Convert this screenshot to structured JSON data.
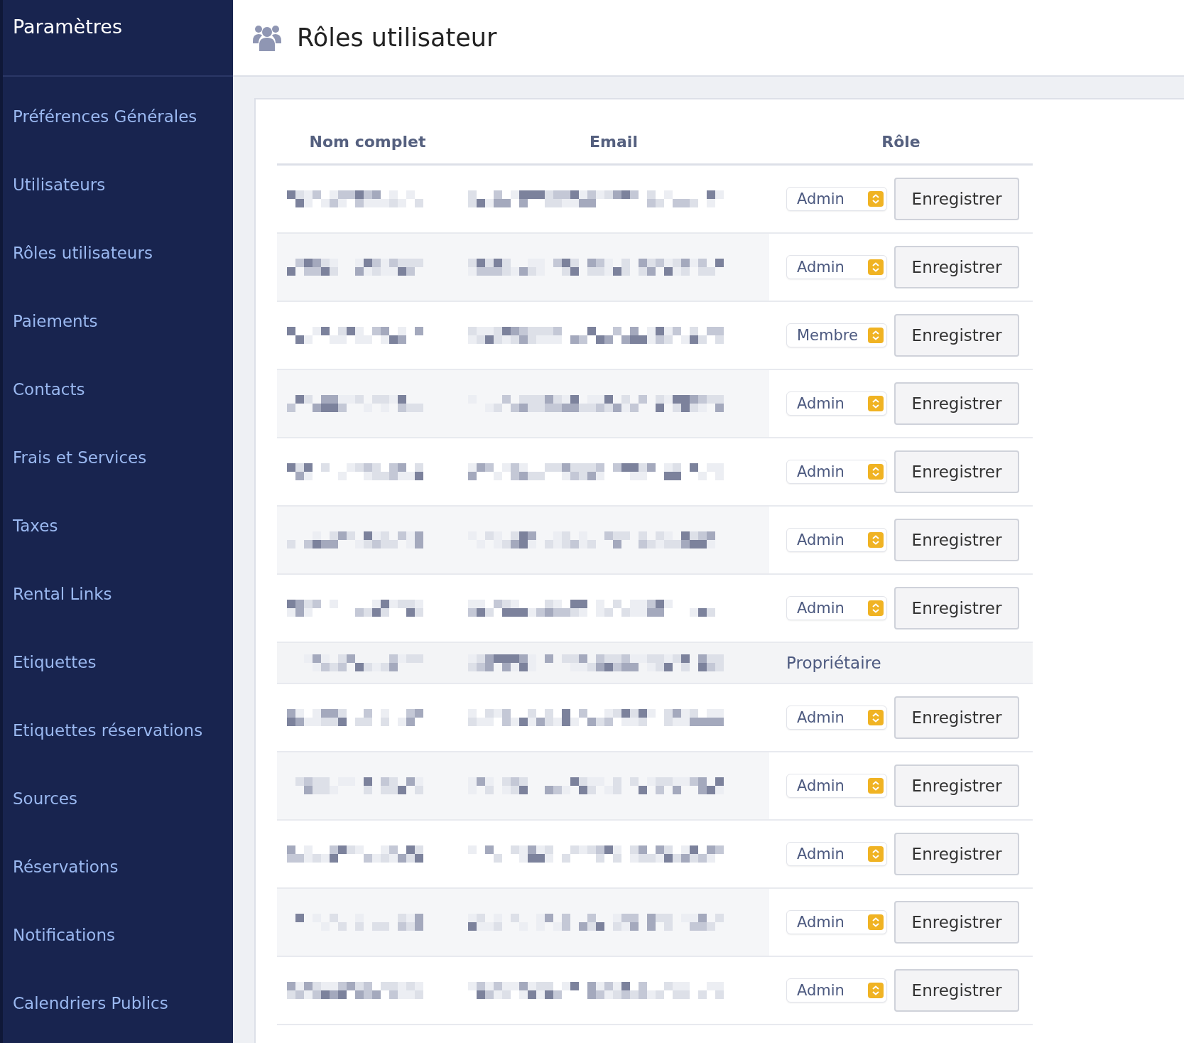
{
  "sidebar": {
    "title": "Paramètres",
    "items": [
      {
        "label": "Préférences Générales"
      },
      {
        "label": "Utilisateurs"
      },
      {
        "label": "Rôles utilisateurs"
      },
      {
        "label": "Paiements"
      },
      {
        "label": "Contacts"
      },
      {
        "label": "Frais et Services"
      },
      {
        "label": "Taxes"
      },
      {
        "label": "Rental Links"
      },
      {
        "label": "Etiquettes"
      },
      {
        "label": "Etiquettes réservations"
      },
      {
        "label": "Sources"
      },
      {
        "label": "Réservations"
      },
      {
        "label": "Notifications"
      },
      {
        "label": "Calendriers Publics"
      }
    ]
  },
  "header": {
    "title": "Rôles utilisateur"
  },
  "table": {
    "columns": [
      "Nom complet",
      "Email",
      "Rôle"
    ],
    "rows": [
      {
        "kind": "editable",
        "role": "Admin",
        "button": "Enregistrer"
      },
      {
        "kind": "editable",
        "role": "Admin",
        "button": "Enregistrer"
      },
      {
        "kind": "editable",
        "role": "Membre",
        "button": "Enregistrer"
      },
      {
        "kind": "editable",
        "role": "Admin",
        "button": "Enregistrer"
      },
      {
        "kind": "editable",
        "role": "Admin",
        "button": "Enregistrer"
      },
      {
        "kind": "editable",
        "role": "Admin",
        "button": "Enregistrer"
      },
      {
        "kind": "editable",
        "role": "Admin",
        "button": "Enregistrer"
      },
      {
        "kind": "owner",
        "role": "Propriétaire"
      },
      {
        "kind": "editable",
        "role": "Admin",
        "button": "Enregistrer"
      },
      {
        "kind": "editable",
        "role": "Admin",
        "button": "Enregistrer"
      },
      {
        "kind": "editable",
        "role": "Admin",
        "button": "Enregistrer"
      },
      {
        "kind": "editable",
        "role": "Admin",
        "button": "Enregistrer"
      },
      {
        "kind": "editable",
        "role": "Admin",
        "button": "Enregistrer"
      }
    ]
  }
}
